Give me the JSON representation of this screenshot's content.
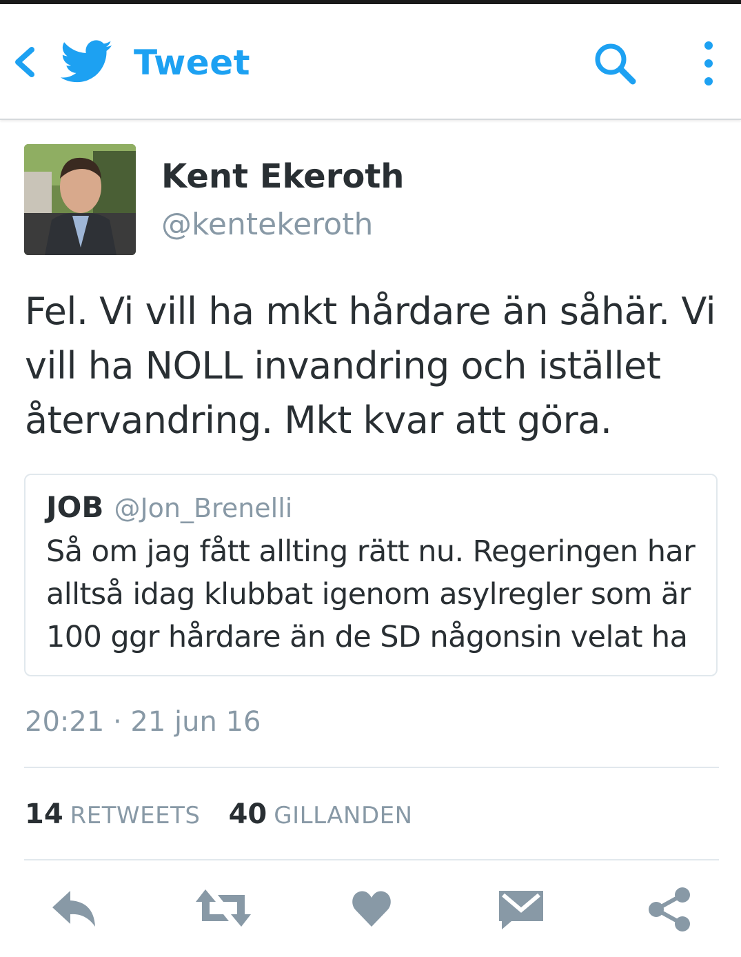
{
  "header": {
    "title": "Tweet",
    "accent_color": "#1da1f2",
    "icons": [
      "back-arrow-icon",
      "twitter-bird-icon",
      "search-icon",
      "overflow-menu-icon"
    ]
  },
  "tweet": {
    "author_name": "Kent Ekeroth",
    "author_handle": "@kentekeroth",
    "text": "Fel. Vi vill ha mkt hårdare än såhär. Vi vill ha NOLL invandring och istället återvandring. Mkt kvar att göra.",
    "timestamp": "20:21 · 21 jun 16"
  },
  "quoted_tweet": {
    "author_name": "JOB",
    "author_handle": "@Jon_Brenelli",
    "text": "Så om jag fått allting rätt nu. Regeringen har alltså idag klubbat igenom asylregler som är 100 ggr hårdare än de SD någonsin velat ha"
  },
  "stats": {
    "retweets_count": "14",
    "retweets_label": "RETWEETS",
    "likes_count": "40",
    "likes_label": "GILLANDEN"
  },
  "actions": {
    "icons": [
      "reply-icon",
      "retweet-icon",
      "like-icon",
      "direct-message-icon",
      "share-icon"
    ],
    "icon_color": "#8899a6"
  }
}
